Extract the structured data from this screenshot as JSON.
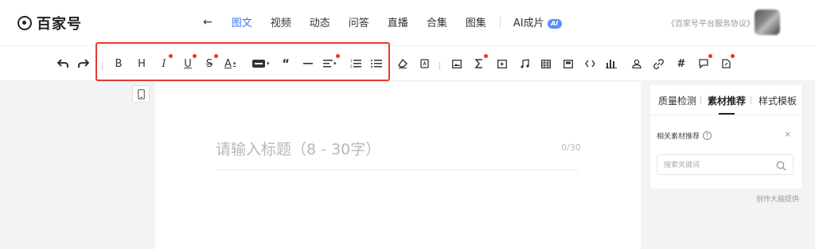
{
  "brand": {
    "name": "百家号"
  },
  "nav": {
    "items": [
      "图文",
      "视频",
      "动态",
      "问答",
      "直播",
      "合集",
      "图集"
    ],
    "active": "图文",
    "ai_item": "AI成片",
    "ai_badge": "AI"
  },
  "header": {
    "agreement": "《百家号平台服务协议》"
  },
  "toolbar": {
    "bold": "B",
    "heading": "H",
    "italic": "I",
    "underline": "U",
    "strike": "S",
    "font_color": "A",
    "quote": "“",
    "hash": "#"
  },
  "editor": {
    "title_placeholder": "请输入标题（8 - 30字）",
    "title_count": "0/30"
  },
  "panel": {
    "tabs": [
      "质量检测",
      "素材推荐",
      "样式模板"
    ],
    "active_tab": "素材推荐",
    "subheading": "相关素材推荐",
    "help": "?",
    "close": "×",
    "search_placeholder": "搜索关键词"
  },
  "footer": {
    "credit": "创作大脑提供"
  },
  "colors": {
    "accent": "#3377ff",
    "highlight": "#e53935",
    "dot": "#e6352b"
  }
}
